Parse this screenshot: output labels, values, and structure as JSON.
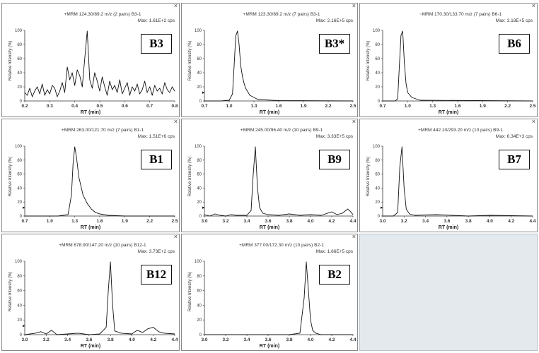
{
  "window": {
    "close_glyph": "×"
  },
  "chart_data": [
    {
      "type": "line",
      "tag": "B3",
      "header1": "+MRM 124.30/89.2 m/z (2 pairs) B3-1",
      "header2": "Max: 1.61E+2 cps",
      "xlabel": "RT (min)",
      "ylabel": "Relative Intensity (%)",
      "xlim": [
        0.2,
        0.8
      ],
      "ylim": [
        0,
        100
      ],
      "xticks": [
        "0.2",
        "0.3",
        "0.4",
        "0.5",
        "0.6",
        "0.7",
        "0.8"
      ],
      "yticks": [
        "0",
        "20",
        "40",
        "60",
        "80",
        "100"
      ],
      "x": [
        0.2,
        0.21,
        0.22,
        0.23,
        0.24,
        0.25,
        0.26,
        0.27,
        0.28,
        0.29,
        0.3,
        0.31,
        0.32,
        0.33,
        0.34,
        0.35,
        0.36,
        0.37,
        0.38,
        0.39,
        0.4,
        0.41,
        0.42,
        0.43,
        0.44,
        0.45,
        0.46,
        0.47,
        0.48,
        0.49,
        0.5,
        0.51,
        0.52,
        0.53,
        0.54,
        0.55,
        0.56,
        0.57,
        0.58,
        0.59,
        0.6,
        0.61,
        0.62,
        0.63,
        0.64,
        0.65,
        0.66,
        0.67,
        0.68,
        0.69,
        0.7,
        0.71,
        0.72,
        0.73,
        0.74,
        0.75,
        0.76,
        0.77,
        0.78,
        0.79,
        0.8
      ],
      "y": [
        12,
        8,
        18,
        6,
        14,
        20,
        10,
        24,
        8,
        16,
        10,
        22,
        18,
        6,
        14,
        26,
        12,
        48,
        30,
        40,
        22,
        44,
        36,
        20,
        60,
        99,
        30,
        18,
        40,
        28,
        14,
        34,
        20,
        8,
        28,
        16,
        22,
        12,
        30,
        10,
        18,
        26,
        8,
        20,
        14,
        24,
        10,
        16,
        28,
        12,
        20,
        8,
        22,
        14,
        18,
        10,
        26,
        16,
        12,
        20,
        14
      ]
    },
    {
      "type": "line",
      "tag": "B3*",
      "header1": "+MRM 123.30/89.2 m/z (7 pairs) B3-1",
      "header2": "Max: 2.16E+5 cps",
      "xlabel": "RT (min)",
      "ylabel": "Relative Intensity (%)",
      "xlim": [
        0.7,
        2.5
      ],
      "ylim": [
        0,
        100
      ],
      "xticks": [
        "0.7",
        "1.0",
        "1.3",
        "1.6",
        "1.9",
        "2.2",
        "2.5"
      ],
      "yticks": [
        "0",
        "20",
        "40",
        "60",
        "80",
        "100"
      ],
      "x": [
        0.7,
        0.9,
        1.0,
        1.04,
        1.06,
        1.08,
        1.1,
        1.12,
        1.14,
        1.16,
        1.18,
        1.2,
        1.25,
        1.35,
        1.6,
        2.5
      ],
      "y": [
        0,
        0,
        1,
        10,
        50,
        92,
        99,
        80,
        50,
        35,
        25,
        18,
        8,
        2,
        0.5,
        0
      ],
      "marker": "▸"
    },
    {
      "type": "line",
      "tag": "B6",
      "header1": "~MRM 170.30/133.70 m/z (7 pairs) B6-1",
      "header2": "Max: 3.18E+5 cps",
      "xlabel": "RT (min)",
      "ylabel": "Relative Intensity (%)",
      "xlim": [
        0.7,
        2.5
      ],
      "ylim": [
        0,
        100
      ],
      "xticks": [
        "0.7",
        "1.0",
        "1.3",
        "1.6",
        "1.9",
        "2.2",
        "2.5"
      ],
      "yticks": [
        "0",
        "20",
        "40",
        "60",
        "80",
        "100"
      ],
      "x": [
        0.7,
        0.85,
        0.88,
        0.9,
        0.92,
        0.94,
        0.96,
        0.98,
        1.0,
        1.05,
        1.15,
        2.5
      ],
      "y": [
        0,
        0,
        3,
        50,
        93,
        99,
        55,
        25,
        12,
        5,
        1,
        0
      ]
    },
    {
      "type": "line",
      "tag": "B1",
      "header1": "+MRM 263.00/121.70 m/z (7 pairs) B1-1",
      "header2": "Max: 1.51E+6 cps",
      "xlabel": "RT (min)",
      "ylabel": "Relative Intensity (%)",
      "xlim": [
        0.7,
        2.5
      ],
      "ylim": [
        0,
        100
      ],
      "xticks": [
        "0.7",
        "1.0",
        "1.3",
        "1.6",
        "1.9",
        "2.2",
        "2.5"
      ],
      "yticks": [
        "0",
        "20",
        "40",
        "60",
        "80",
        "100"
      ],
      "x": [
        0.7,
        1.1,
        1.22,
        1.26,
        1.28,
        1.3,
        1.32,
        1.35,
        1.4,
        1.45,
        1.5,
        1.55,
        1.6,
        1.7,
        1.9,
        2.5
      ],
      "y": [
        0,
        0,
        2,
        30,
        75,
        99,
        85,
        55,
        30,
        18,
        10,
        5,
        3,
        1,
        0,
        0
      ],
      "marker": "▸"
    },
    {
      "type": "line",
      "tag": "B9",
      "header1": "+MRM 245.00/96.40 m/z (10 pairs) B9-1",
      "header2": "Max: 3.33E+5 cps",
      "xlabel": "RT (min)",
      "ylabel": "Relative Intensity (%)",
      "xlim": [
        3.0,
        4.4
      ],
      "ylim": [
        0,
        100
      ],
      "xticks": [
        "3.0",
        "3.2",
        "3.4",
        "3.6",
        "3.8",
        "4.0",
        "4.2",
        "4.4"
      ],
      "yticks": [
        "0",
        "20",
        "40",
        "60",
        "80",
        "100"
      ],
      "x": [
        3.0,
        3.05,
        3.1,
        3.15,
        3.2,
        3.25,
        3.3,
        3.4,
        3.44,
        3.46,
        3.48,
        3.5,
        3.52,
        3.55,
        3.6,
        3.7,
        3.8,
        3.9,
        4.0,
        4.1,
        4.2,
        4.25,
        4.3,
        4.35,
        4.38,
        4.4
      ],
      "y": [
        2,
        0,
        3,
        1,
        0,
        2,
        1,
        1,
        8,
        60,
        99,
        40,
        12,
        4,
        2,
        1,
        3,
        1,
        2,
        1,
        6,
        2,
        4,
        10,
        6,
        2
      ],
      "marker": "▸"
    },
    {
      "type": "line",
      "tag": "B7",
      "header1": "+MRM 442.10/293.20 m/z (10 pairs) B9-1",
      "header2": "Max: 6.34E+3 cps",
      "xlabel": "RT (min)",
      "ylabel": "Relative Intensity (%)",
      "xlim": [
        3.0,
        4.4
      ],
      "ylim": [
        0,
        100
      ],
      "xticks": [
        "3.0",
        "3.2",
        "3.4",
        "3.6",
        "3.8",
        "4.0",
        "4.2",
        "4.4"
      ],
      "yticks": [
        "0",
        "20",
        "40",
        "60",
        "80",
        "100"
      ],
      "x": [
        3.0,
        3.1,
        3.14,
        3.16,
        3.18,
        3.2,
        3.22,
        3.25,
        3.3,
        3.5,
        3.8,
        4.0,
        4.4
      ],
      "y": [
        0,
        0,
        5,
        70,
        99,
        40,
        10,
        3,
        1,
        2,
        0,
        1,
        0
      ],
      "marker": "▸"
    },
    {
      "type": "line",
      "tag": "B12",
      "header1": "+MRM 678.90/147.20 m/z (10 pairs) B12-1",
      "header2": "Max: 3.73E+2 cps",
      "xlabel": "RT (min)",
      "ylabel": "Relative Intensity (%)",
      "xlim": [
        3.0,
        4.4
      ],
      "ylim": [
        0,
        100
      ],
      "xticks": [
        "3.0",
        "3.2",
        "3.4",
        "3.6",
        "3.8",
        "4.0",
        "4.2",
        "4.4"
      ],
      "yticks": [
        "0",
        "20",
        "40",
        "60",
        "80",
        "100"
      ],
      "x": [
        3.0,
        3.1,
        3.15,
        3.2,
        3.25,
        3.3,
        3.4,
        3.5,
        3.6,
        3.7,
        3.76,
        3.78,
        3.8,
        3.82,
        3.84,
        3.9,
        4.0,
        4.05,
        4.1,
        4.15,
        4.2,
        4.25,
        4.3,
        4.4
      ],
      "y": [
        0,
        2,
        4,
        1,
        6,
        0,
        1,
        2,
        0,
        1,
        10,
        60,
        99,
        40,
        5,
        2,
        1,
        6,
        3,
        8,
        10,
        4,
        2,
        1
      ],
      "marker": "▸"
    },
    {
      "type": "line",
      "tag": "B2",
      "header1": "+MRM 377.00/172.30 m/z (10 pairs) B2-1",
      "header2": "Max: 1.66E+5 cps",
      "xlabel": "RT (min)",
      "ylabel": "Relative Intensity (%)",
      "xlim": [
        3.0,
        4.4
      ],
      "ylim": [
        0,
        100
      ],
      "xticks": [
        "3.0",
        "3.2",
        "3.4",
        "3.6",
        "3.8",
        "4.0",
        "4.2",
        "4.4"
      ],
      "yticks": [
        "0",
        "20",
        "40",
        "60",
        "80",
        "100"
      ],
      "x": [
        3.0,
        3.8,
        3.9,
        3.94,
        3.96,
        3.98,
        4.0,
        4.02,
        4.05,
        4.1,
        4.4
      ],
      "y": [
        0,
        0,
        2,
        50,
        99,
        60,
        20,
        6,
        2,
        0,
        0
      ]
    }
  ]
}
